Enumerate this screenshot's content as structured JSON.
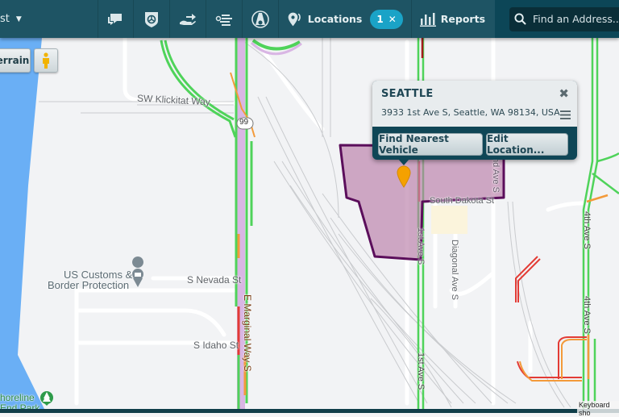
{
  "topbar": {
    "left_label": "st",
    "icons": [
      {
        "name": "messages-icon"
      },
      {
        "name": "shield-badge-icon"
      },
      {
        "name": "hand-transfer-icon"
      },
      {
        "name": "map-list-icon"
      },
      {
        "name": "road-circle-icon"
      }
    ],
    "locations_label": "Locations",
    "locations_count": "1",
    "locations_clear": "✕",
    "reports_label": "Reports",
    "search_placeholder": "Find an Address..."
  },
  "map_controls": {
    "terrain_label": "errain",
    "pegman": "pegman-icon"
  },
  "popup": {
    "title": "SEATTLE",
    "address": "3933 1st Ave S, Seattle, WA 98134, USA",
    "close": "✖",
    "find_nearest_label": "Find Nearest Vehicle",
    "edit_location_label": "Edit Location..."
  },
  "map_labels": {
    "klickitat": "SW Klickitat Way",
    "route99": "99",
    "customs1": "US Customs &",
    "customs2": "Border Protection",
    "nevada": "S Nevada St",
    "idaho": "S Idaho St",
    "marginal": "E Marginal Way S",
    "dakota": "South Dakota St",
    "second_ave": "nd Ave S",
    "diagonal": "Diagonal Ave S",
    "first_ave": "1st Ave S",
    "first_ave_top": "1st Ave S",
    "fourth_ave1": "4th Ave S",
    "fourth_ave2": "4th Ave S",
    "park1": "horeline",
    "park2": "End Park"
  },
  "footer": {
    "keyboard_label": "Keyboard sho"
  },
  "colors": {
    "header": "#1e5464",
    "accent_badge": "#1aa3c7",
    "geofence_fill": "#c08fb5",
    "geofence_stroke": "#5b0e5b",
    "traffic_green": "#4fd35a",
    "traffic_orange": "#f39a3a",
    "traffic_red": "#e33b35",
    "water": "#6aaff5",
    "marker": "#f5a100"
  }
}
